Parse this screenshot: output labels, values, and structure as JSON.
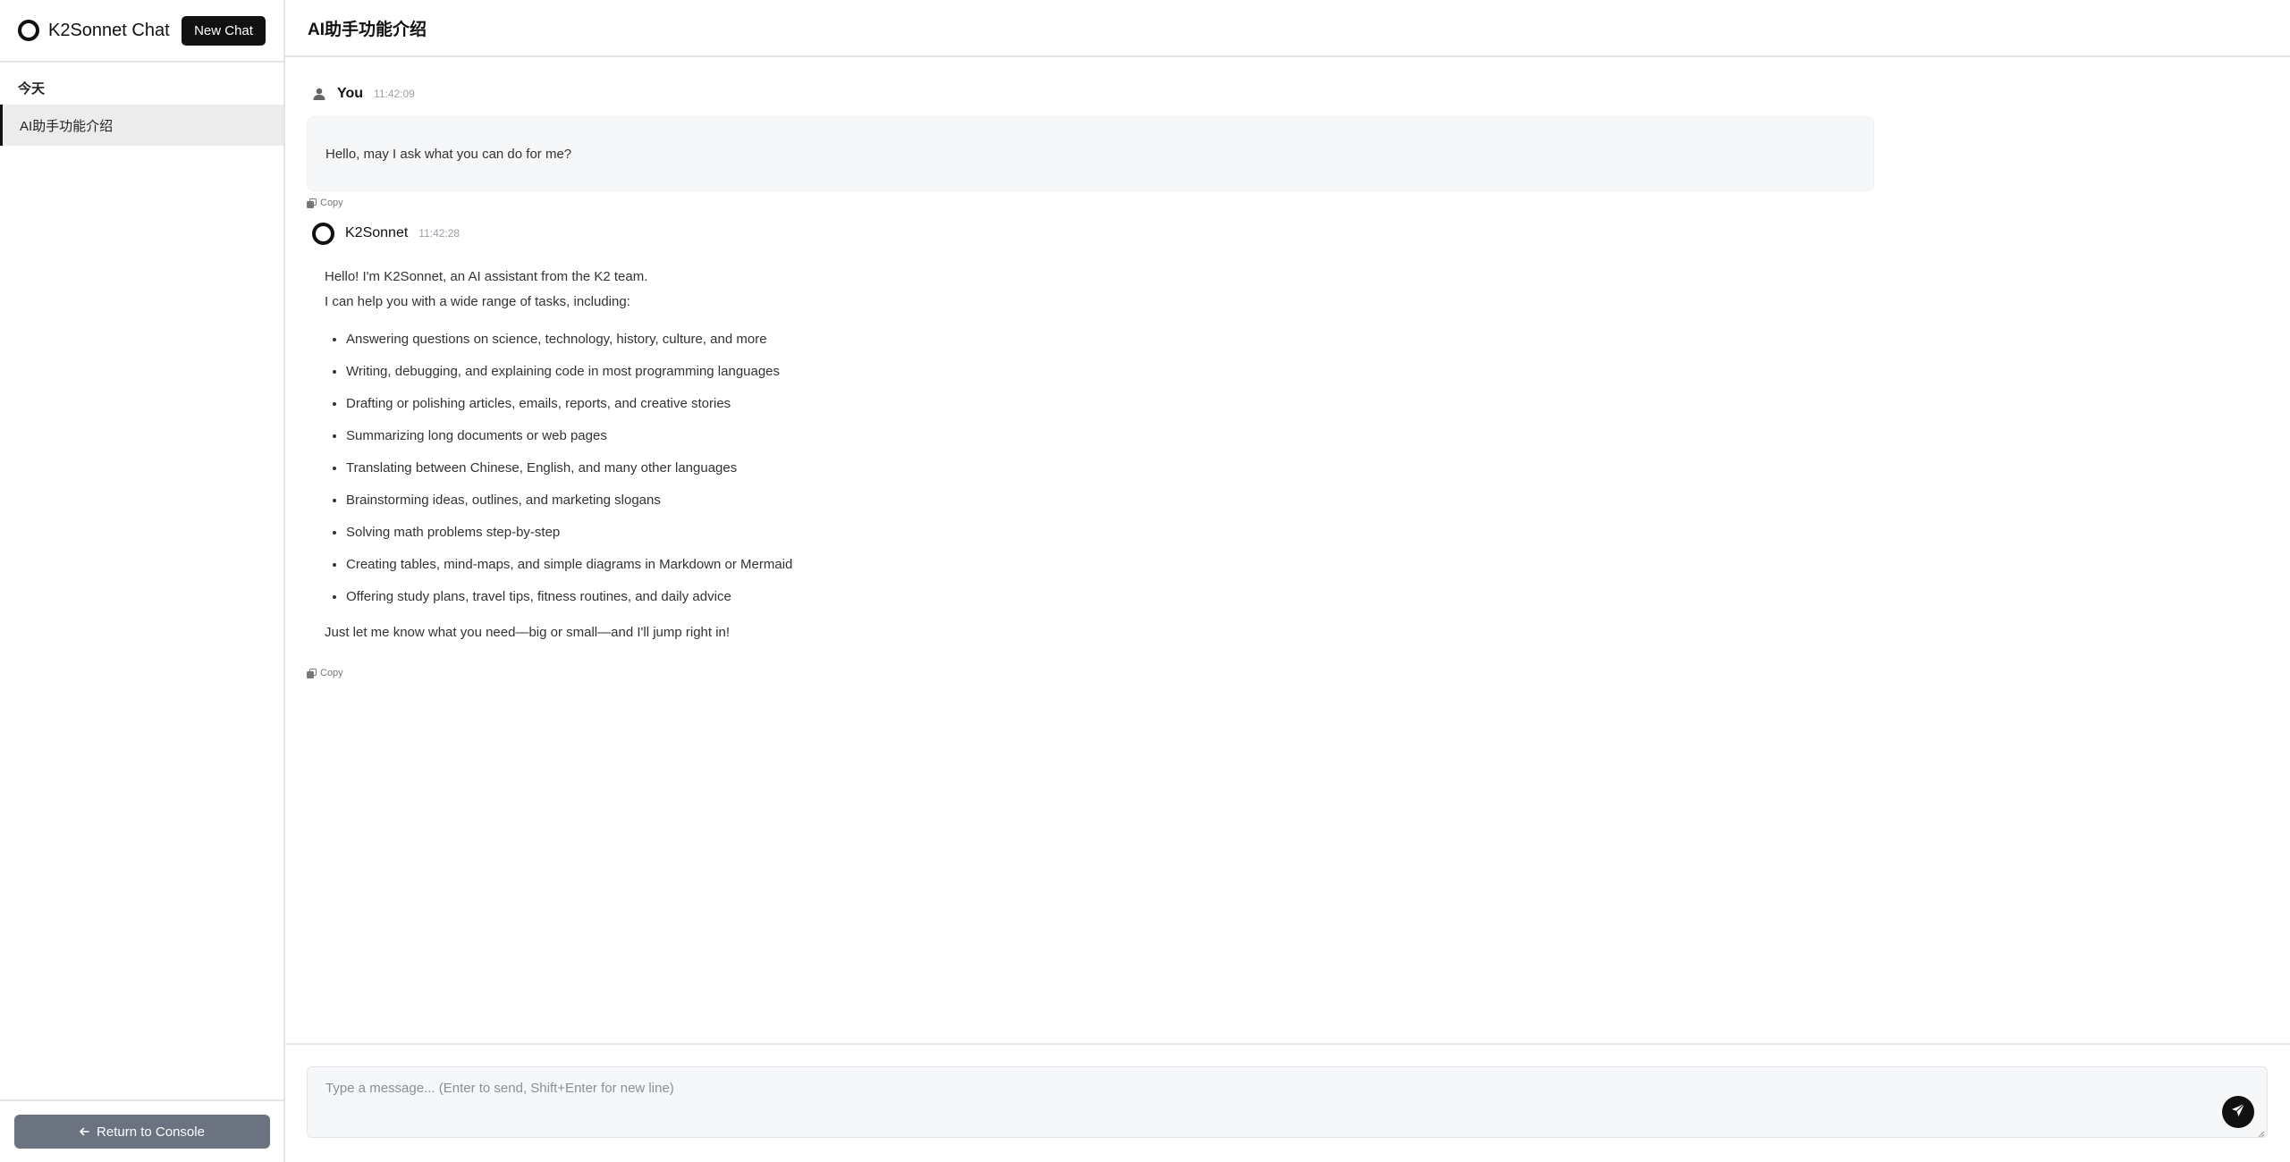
{
  "sidebar": {
    "brand": "K2Sonnet Chat",
    "new_chat_label": "New Chat",
    "section_label": "今天",
    "chats": [
      {
        "label": "AI助手功能介绍"
      }
    ],
    "return_label": "Return to Console"
  },
  "header": {
    "title": "AI助手功能介绍"
  },
  "messages": {
    "user": {
      "author": "You",
      "time": "11:42:09",
      "text": "Hello, may I ask what you can do for me?",
      "copy_label": "Copy"
    },
    "assistant": {
      "author": "K2Sonnet",
      "time": "11:42:28",
      "intro_line1": "Hello! I'm K2Sonnet, an AI assistant from the K2 team.",
      "intro_line2": "I can help you with a wide range of tasks, including:",
      "items": [
        "Answering questions on science, technology, history, culture, and more",
        "Writing, debugging, and explaining code in most programming languages",
        "Drafting or polishing articles, emails, reports, and creative stories",
        "Summarizing long documents or web pages",
        "Translating between Chinese, English, and many other languages",
        "Brainstorming ideas, outlines, and marketing slogans",
        "Solving math problems step-by-step",
        "Creating tables, mind-maps, and simple diagrams in Markdown or Mermaid",
        "Offering study plans, travel tips, fitness routines, and daily advice"
      ],
      "closing": "Just let me know what you need—big or small—and I'll jump right in!",
      "copy_label": "Copy"
    }
  },
  "composer": {
    "placeholder": "Type a message... (Enter to send, Shift+Enter for new line)"
  },
  "icons": {
    "logo": "ring-logo-icon",
    "user": "user-icon",
    "assistant": "ring-avatar-icon",
    "copy": "copy-icon",
    "send": "send-icon",
    "back": "arrow-left-icon"
  },
  "colors": {
    "accent": "#111111",
    "return_button": "#6b7280",
    "bubble": "#f6f7f9"
  }
}
